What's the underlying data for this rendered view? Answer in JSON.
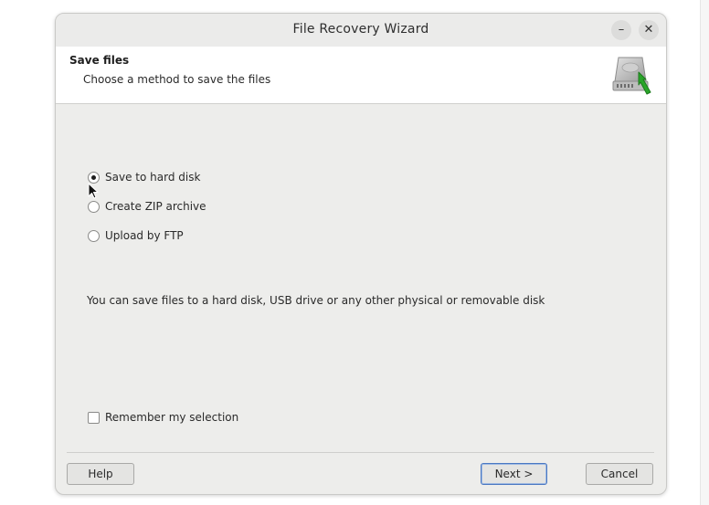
{
  "window": {
    "title": "File Recovery Wizard",
    "minimize_glyph": "–",
    "close_glyph": "✕"
  },
  "header": {
    "title": "Save files",
    "subtitle": "Choose a method to save the files",
    "icon": "hard-disk-save-icon"
  },
  "options": [
    {
      "label": "Save to hard disk",
      "selected": true
    },
    {
      "label": "Create ZIP archive",
      "selected": false
    },
    {
      "label": "Upload by FTP",
      "selected": false
    }
  ],
  "info_text": "You can save files to a hard disk, USB drive or any other physical or removable disk",
  "remember": {
    "label": "Remember my selection",
    "checked": false
  },
  "buttons": {
    "help": "Help",
    "next": "Next >",
    "cancel": "Cancel"
  },
  "colors": {
    "dialog_bg": "#ededeb",
    "header_bg": "#ffffff",
    "default_button_border": "#4a78c2",
    "icon_arrow": "#2aa52a"
  }
}
